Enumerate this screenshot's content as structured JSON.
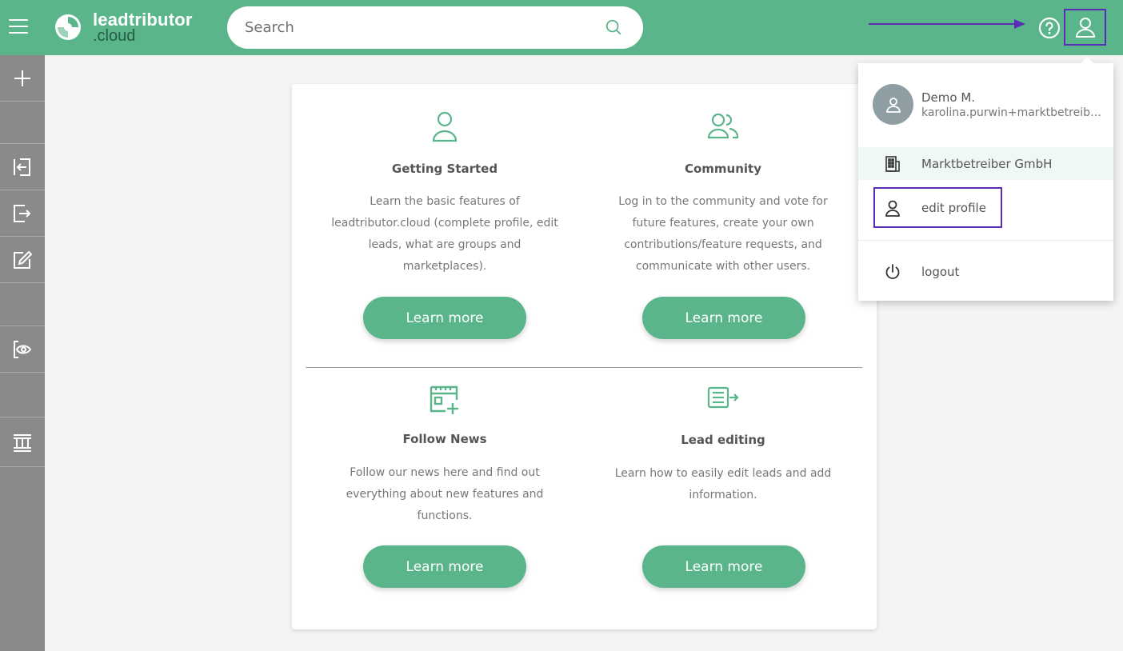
{
  "brand": {
    "name": "leadtributor",
    "domain": ".cloud"
  },
  "search": {
    "placeholder": "Search"
  },
  "colors": {
    "primary": "#5ab68a",
    "sidebar": "#8a8a8a",
    "highlight": "#5a2bb5"
  },
  "sidebar": {
    "items": [
      {
        "icon": "plus-icon"
      },
      {
        "icon": "sign-in-icon"
      },
      {
        "icon": "sign-out-icon"
      },
      {
        "icon": "edit-icon"
      },
      {
        "icon": "eye-icon"
      },
      {
        "icon": "marketplace-icon"
      }
    ]
  },
  "tiles": [
    {
      "icon": "user-icon",
      "title": "Getting Started",
      "lines": [
        "Learn the basic features of",
        "leadtributor.cloud (complete profile, edit",
        "leads, what are groups and",
        "marketplaces)."
      ],
      "button": "Learn more"
    },
    {
      "icon": "users-icon",
      "title": "Community",
      "lines": [
        "Log in to the community and vote for",
        "future features, create your own",
        "contributions/feature requests, and",
        "communicate with other users."
      ],
      "button": "Learn more"
    },
    {
      "icon": "news-icon",
      "title": "Follow News",
      "lines": [
        "Follow our news here and find out",
        "everything about new features and",
        "functions."
      ],
      "button": "Learn more"
    },
    {
      "icon": "lead-edit-icon",
      "title": "Lead editing",
      "lines": [
        "Learn how to easily edit leads and add",
        "information."
      ],
      "button": "Learn more"
    }
  ],
  "dropdown": {
    "user_name": "Demo M.",
    "user_email": "karolina.purwin+marktbetreiber@leadtributor.cloud",
    "company": "Marktbetreiber GmbH",
    "edit_profile": "edit profile",
    "logout": "logout"
  }
}
